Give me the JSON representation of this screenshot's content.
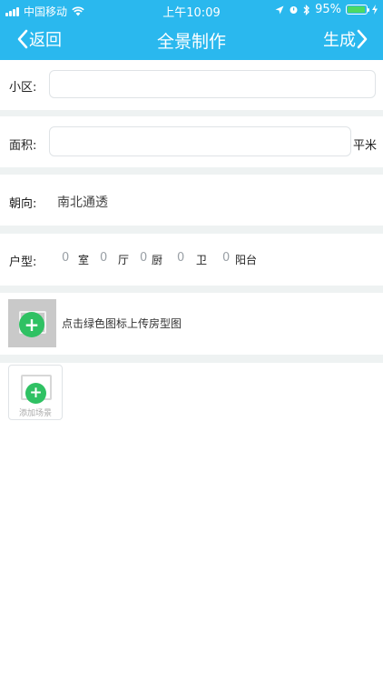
{
  "status_bar": {
    "carrier": "中国移动",
    "time": "上午10:09",
    "battery_percent": "95%",
    "battery_level": 0.95
  },
  "nav": {
    "back_label": "返回",
    "title": "全景制作",
    "action_label": "生成"
  },
  "form": {
    "community": {
      "label": "小区:",
      "value": ""
    },
    "area": {
      "label": "面积:",
      "value": "",
      "unit": "平米"
    },
    "orientation": {
      "label": "朝向:",
      "value": "南北通透"
    },
    "layout": {
      "label": "户型:",
      "items": [
        {
          "count": "0",
          "unit": "室"
        },
        {
          "count": "0",
          "unit": "厅"
        },
        {
          "count": "0",
          "unit": "厨"
        },
        {
          "count": "0",
          "unit": "卫"
        },
        {
          "count": "0",
          "unit": "阳台"
        }
      ]
    },
    "floorplan": {
      "hint": "点击绿色图标上传房型图"
    },
    "scene": {
      "caption": "添加场景"
    }
  },
  "colors": {
    "header": "#2ab8ee",
    "accent_green": "#2fc163",
    "separator": "#eef2f2"
  }
}
